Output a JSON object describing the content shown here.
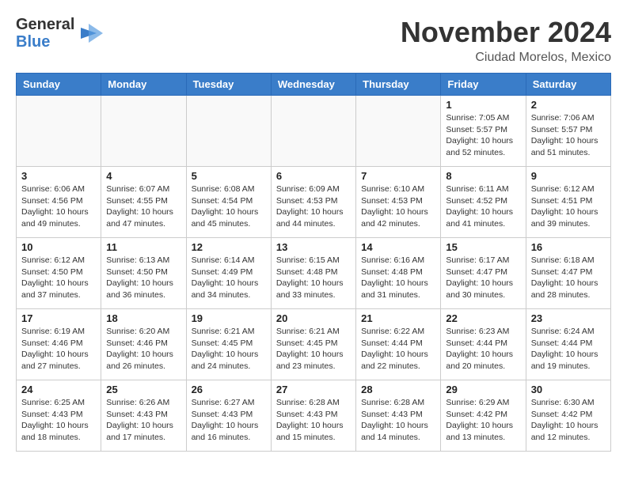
{
  "header": {
    "logo_general": "General",
    "logo_blue": "Blue",
    "month_title": "November 2024",
    "subtitle": "Ciudad Morelos, Mexico"
  },
  "weekdays": [
    "Sunday",
    "Monday",
    "Tuesday",
    "Wednesday",
    "Thursday",
    "Friday",
    "Saturday"
  ],
  "weeks": [
    [
      {
        "day": "",
        "info": ""
      },
      {
        "day": "",
        "info": ""
      },
      {
        "day": "",
        "info": ""
      },
      {
        "day": "",
        "info": ""
      },
      {
        "day": "",
        "info": ""
      },
      {
        "day": "1",
        "info": "Sunrise: 7:05 AM\nSunset: 5:57 PM\nDaylight: 10 hours\nand 52 minutes."
      },
      {
        "day": "2",
        "info": "Sunrise: 7:06 AM\nSunset: 5:57 PM\nDaylight: 10 hours\nand 51 minutes."
      }
    ],
    [
      {
        "day": "3",
        "info": "Sunrise: 6:06 AM\nSunset: 4:56 PM\nDaylight: 10 hours\nand 49 minutes."
      },
      {
        "day": "4",
        "info": "Sunrise: 6:07 AM\nSunset: 4:55 PM\nDaylight: 10 hours\nand 47 minutes."
      },
      {
        "day": "5",
        "info": "Sunrise: 6:08 AM\nSunset: 4:54 PM\nDaylight: 10 hours\nand 45 minutes."
      },
      {
        "day": "6",
        "info": "Sunrise: 6:09 AM\nSunset: 4:53 PM\nDaylight: 10 hours\nand 44 minutes."
      },
      {
        "day": "7",
        "info": "Sunrise: 6:10 AM\nSunset: 4:53 PM\nDaylight: 10 hours\nand 42 minutes."
      },
      {
        "day": "8",
        "info": "Sunrise: 6:11 AM\nSunset: 4:52 PM\nDaylight: 10 hours\nand 41 minutes."
      },
      {
        "day": "9",
        "info": "Sunrise: 6:12 AM\nSunset: 4:51 PM\nDaylight: 10 hours\nand 39 minutes."
      }
    ],
    [
      {
        "day": "10",
        "info": "Sunrise: 6:12 AM\nSunset: 4:50 PM\nDaylight: 10 hours\nand 37 minutes."
      },
      {
        "day": "11",
        "info": "Sunrise: 6:13 AM\nSunset: 4:50 PM\nDaylight: 10 hours\nand 36 minutes."
      },
      {
        "day": "12",
        "info": "Sunrise: 6:14 AM\nSunset: 4:49 PM\nDaylight: 10 hours\nand 34 minutes."
      },
      {
        "day": "13",
        "info": "Sunrise: 6:15 AM\nSunset: 4:48 PM\nDaylight: 10 hours\nand 33 minutes."
      },
      {
        "day": "14",
        "info": "Sunrise: 6:16 AM\nSunset: 4:48 PM\nDaylight: 10 hours\nand 31 minutes."
      },
      {
        "day": "15",
        "info": "Sunrise: 6:17 AM\nSunset: 4:47 PM\nDaylight: 10 hours\nand 30 minutes."
      },
      {
        "day": "16",
        "info": "Sunrise: 6:18 AM\nSunset: 4:47 PM\nDaylight: 10 hours\nand 28 minutes."
      }
    ],
    [
      {
        "day": "17",
        "info": "Sunrise: 6:19 AM\nSunset: 4:46 PM\nDaylight: 10 hours\nand 27 minutes."
      },
      {
        "day": "18",
        "info": "Sunrise: 6:20 AM\nSunset: 4:46 PM\nDaylight: 10 hours\nand 26 minutes."
      },
      {
        "day": "19",
        "info": "Sunrise: 6:21 AM\nSunset: 4:45 PM\nDaylight: 10 hours\nand 24 minutes."
      },
      {
        "day": "20",
        "info": "Sunrise: 6:21 AM\nSunset: 4:45 PM\nDaylight: 10 hours\nand 23 minutes."
      },
      {
        "day": "21",
        "info": "Sunrise: 6:22 AM\nSunset: 4:44 PM\nDaylight: 10 hours\nand 22 minutes."
      },
      {
        "day": "22",
        "info": "Sunrise: 6:23 AM\nSunset: 4:44 PM\nDaylight: 10 hours\nand 20 minutes."
      },
      {
        "day": "23",
        "info": "Sunrise: 6:24 AM\nSunset: 4:44 PM\nDaylight: 10 hours\nand 19 minutes."
      }
    ],
    [
      {
        "day": "24",
        "info": "Sunrise: 6:25 AM\nSunset: 4:43 PM\nDaylight: 10 hours\nand 18 minutes."
      },
      {
        "day": "25",
        "info": "Sunrise: 6:26 AM\nSunset: 4:43 PM\nDaylight: 10 hours\nand 17 minutes."
      },
      {
        "day": "26",
        "info": "Sunrise: 6:27 AM\nSunset: 4:43 PM\nDaylight: 10 hours\nand 16 minutes."
      },
      {
        "day": "27",
        "info": "Sunrise: 6:28 AM\nSunset: 4:43 PM\nDaylight: 10 hours\nand 15 minutes."
      },
      {
        "day": "28",
        "info": "Sunrise: 6:28 AM\nSunset: 4:43 PM\nDaylight: 10 hours\nand 14 minutes."
      },
      {
        "day": "29",
        "info": "Sunrise: 6:29 AM\nSunset: 4:42 PM\nDaylight: 10 hours\nand 13 minutes."
      },
      {
        "day": "30",
        "info": "Sunrise: 6:30 AM\nSunset: 4:42 PM\nDaylight: 10 hours\nand 12 minutes."
      }
    ]
  ]
}
